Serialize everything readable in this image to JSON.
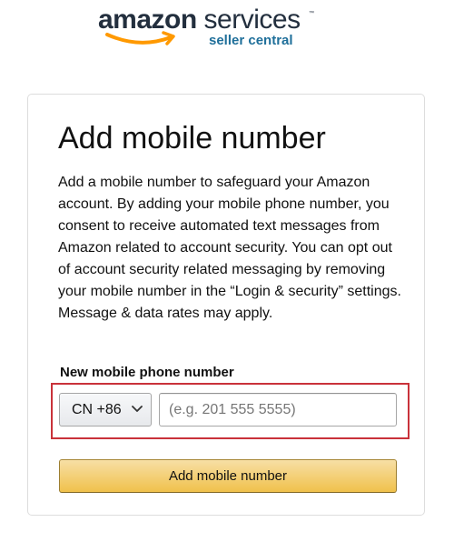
{
  "logo": {
    "brand_bold": "amazon",
    "brand_light": " services",
    "subtitle": "seller central",
    "trademark": "™",
    "brand_color": "#232f3e",
    "smile_color": "#ff9900",
    "subtitle_color": "#1f6f9a"
  },
  "page": {
    "title": "Add mobile number",
    "description": "Add a mobile number to safeguard your Amazon account. By adding your mobile phone number, you consent to receive automated text messages from Amazon related to account security. You can opt out of account security related messaging by removing your mobile number in the “Login & security” settings. Message & data rates may apply."
  },
  "phone_form": {
    "label": "New mobile phone number",
    "country_code": "CN +86",
    "phone_value": "",
    "phone_placeholder": "(e.g. 201 555 5555)",
    "submit_label": "Add mobile number",
    "highlight_color": "#c9323a",
    "button_color": "#f0c14b"
  }
}
